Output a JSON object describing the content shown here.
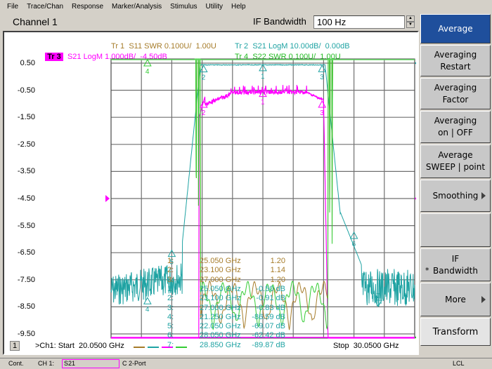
{
  "menu": [
    "File",
    "Trace/Chan",
    "Response",
    "Marker/Analysis",
    "Stimulus",
    "Utility",
    "Help"
  ],
  "channel": {
    "title": "Channel 1",
    "if_bandwidth_label": "IF Bandwidth",
    "if_bandwidth_value": "100 Hz",
    "channel_number": "1"
  },
  "traces": [
    {
      "id": "Tr 1",
      "desc": "S11 SWR 0.100U/  1.00U",
      "color": "#a67c2a",
      "active": false
    },
    {
      "id": "Tr 2",
      "desc": "S21 LogM 10.00dB/  0.00dB",
      "color": "#1fa3a3",
      "active": false
    },
    {
      "id": "Tr 3",
      "desc": "S21 LogM 1.000dB/  -4.50dB",
      "color": "#ff00ff",
      "active": true
    },
    {
      "id": "Tr 4",
      "desc": "S22 SWR 0.100U/  1.00U",
      "color": "#22bb22",
      "active": false
    }
  ],
  "colors": {
    "tr1": "#a67c2a",
    "tr2": "#1fa3a3",
    "tr3": "#ff00ff",
    "tr4": "#33cc33",
    "tr4_dark": "#0a8a0a",
    "softkey_active": "#1f4f9c",
    "grid": "#707070"
  },
  "y_axis": {
    "labels": [
      "0.50",
      "-0.50",
      "-1.50",
      "-2.50",
      "-3.50",
      "-4.50",
      "-5.50",
      "-6.50",
      "-7.50",
      "-8.50",
      "-9.50"
    ],
    "ref_value": "-4.50"
  },
  "stimulus": {
    "start_label": ">Ch1: Start  20.0500 GHz",
    "stop_label": "Stop  30.0500 GHz",
    "start_ghz": 20.05,
    "stop_ghz": 30.05
  },
  "marker_table": {
    "swr_rows": [
      {
        "n": "1:",
        "freq": "25.050 GHz",
        "value": "1.20"
      },
      {
        "n": "2:",
        "freq": "23.100 GHz",
        "value": "1.14"
      },
      {
        "n": "3:",
        "freq": "27.000 GHz",
        "value": "1.20"
      }
    ],
    "logm_rows": [
      {
        "n": "1:",
        "freq": "25.050 GHz",
        "value": "-0.50 dB"
      },
      {
        "n": "2:",
        "freq": "23.100 GHz",
        "value": "-0.91 dB"
      },
      {
        "n": "3:",
        "freq": "27.000 GHz",
        "value": "-0.83 dB"
      },
      {
        "n": "4:",
        "freq": "21.250 GHz",
        "value": "-86.59 dB"
      },
      {
        "n": "5:",
        "freq": "22.050 GHz",
        "value": "-69.07 dB"
      },
      {
        "n": "6:",
        "freq": "28.050 GHz",
        "value": "-62.42 dB"
      },
      {
        "n": "7:",
        "freq": "28.850 GHz",
        "value": "-89.87 dB"
      }
    ]
  },
  "markers": {
    "tr2": [
      {
        "label": "1",
        "freq": 25.05,
        "val_db": -0.5
      },
      {
        "label": "2",
        "freq": 23.1,
        "val_db": -0.91
      },
      {
        "label": "3",
        "freq": 27.0,
        "val_db": -0.83
      },
      {
        "label": "4",
        "freq": 21.25,
        "val_db": -86.59
      },
      {
        "label": "5",
        "freq": 22.05,
        "val_db": -69.07
      },
      {
        "label": "6",
        "freq": 28.05,
        "val_db": -62.42
      },
      {
        "label": "7",
        "freq": 28.85,
        "val_db": -89.87
      }
    ],
    "tr3": [
      {
        "label": "1",
        "freq": 25.05
      },
      {
        "label": "2",
        "freq": 23.1
      },
      {
        "label": "3",
        "freq": 27.0
      }
    ]
  },
  "softkeys": [
    {
      "lines": [
        "Average"
      ],
      "active": true
    },
    {
      "lines": [
        "Averaging",
        "Restart"
      ]
    },
    {
      "lines": [
        "Averaging",
        "Factor"
      ]
    },
    {
      "lines": [
        "Averaging",
        "on | OFF"
      ]
    },
    {
      "lines": [
        "Average",
        "SWEEP | point"
      ]
    },
    {
      "lines": [
        "Smoothing"
      ],
      "submenu": true
    },
    {
      "lines": [
        ""
      ]
    },
    {
      "lines": [
        "IF",
        "Bandwidth"
      ],
      "star": "*"
    },
    {
      "lines": [
        "More"
      ],
      "submenu": true
    },
    {
      "lines": [
        "Transform"
      ],
      "transform": true
    }
  ],
  "status": {
    "mode": "Cont.",
    "channel": "CH 1:",
    "measurement": "S21",
    "cal": "C  2-Port",
    "remote": "LCL"
  }
}
